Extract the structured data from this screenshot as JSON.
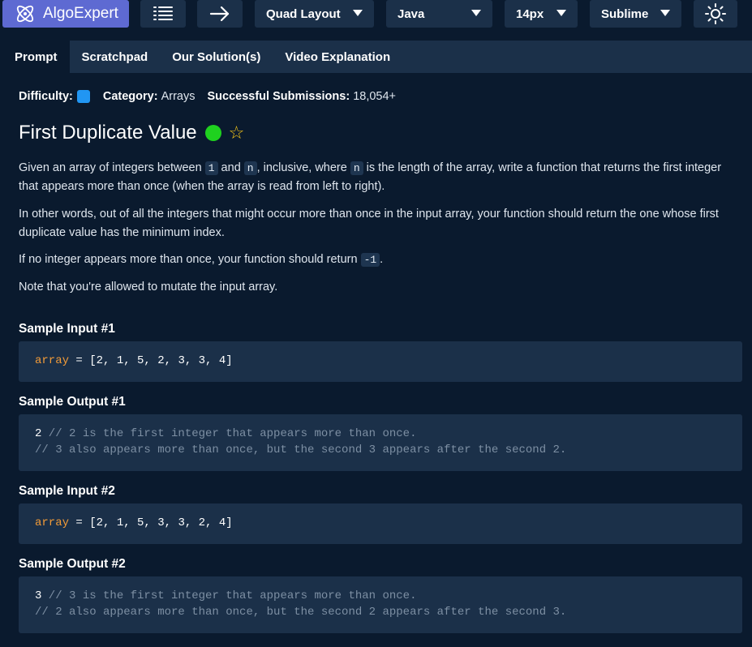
{
  "toolbar": {
    "logo_text": "AlgoExpert",
    "layout_label": "Quad Layout",
    "language_label": "Java",
    "fontsize_label": "14px",
    "keymap_label": "Sublime"
  },
  "tabs": [
    {
      "label": "Prompt",
      "active": true
    },
    {
      "label": "Scratchpad",
      "active": false
    },
    {
      "label": "Our Solution(s)",
      "active": false
    },
    {
      "label": "Video Explanation",
      "active": false
    }
  ],
  "meta": {
    "difficulty_label": "Difficulty:",
    "category_label": "Category:",
    "category_value": "Arrays",
    "submissions_label": "Successful Submissions:",
    "submissions_value": "18,054+"
  },
  "problem": {
    "title": "First Duplicate Value",
    "p1": {
      "t1": "Given an array of integers between ",
      "c1": "1",
      "t2": " and ",
      "c2": "n",
      "t3": ", inclusive, where ",
      "c3": "n",
      "t4": " is the length of the array, write a function that returns the first integer that appears more than once (when the array is read from left to right)."
    },
    "p2": "In other words, out of all the integers that might occur more than once in the input array, your function should return the one whose first duplicate value has the minimum index.",
    "p3": {
      "t1": "If no integer appears more than once, your function should return ",
      "c1": "-1",
      "t2": "."
    },
    "p4": "Note that you're allowed to mutate the input array."
  },
  "samples": {
    "in1_heading": "Sample Input #1",
    "in1_var": "array",
    "in1_rest": " = [2, 1, 5, 2, 3, 3, 4]",
    "out1_heading": "Sample Output #1",
    "out1_value": "2",
    "out1_c1": " // 2 is the first integer that appears more than once.",
    "out1_c2": "// 3 also appears more than once, but the second 3 appears after the second 2.",
    "in2_heading": "Sample Input #2",
    "in2_var": "array",
    "in2_rest": " = [2, 1, 5, 3, 3, 2, 4]",
    "out2_heading": "Sample Output #2",
    "out2_value": "3",
    "out2_c1": " // 3 is the first integer that appears more than once.",
    "out2_c2": "// 2 also appears more than once, but the second 2 appears after the second 3."
  },
  "colors": {
    "background": "#0a1a2e",
    "surface": "#1b3049",
    "brand": "#5e6ad2",
    "difficulty_easy": "#2196f3",
    "completed_dot": "#1fd11f",
    "code_keyword": "#f29b38"
  },
  "icons": [
    "algoexpert-logo-icon",
    "list-icon",
    "arrow-right-icon",
    "chevron-down-icon",
    "sun-icon",
    "star-icon"
  ]
}
